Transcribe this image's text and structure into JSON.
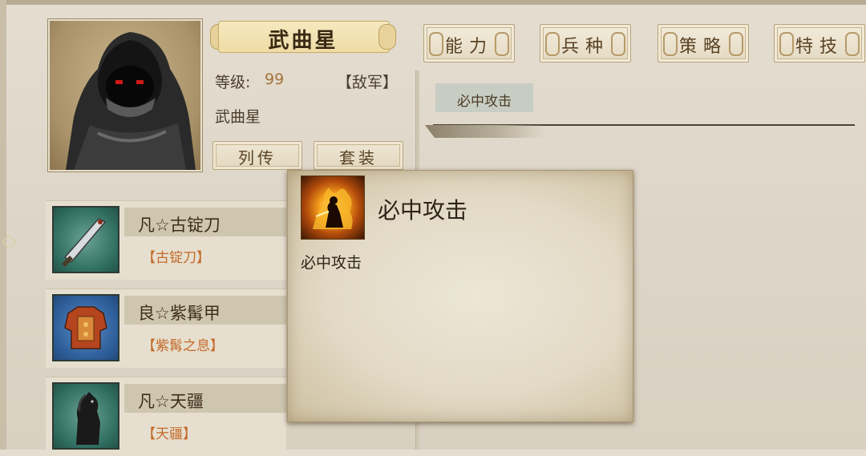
{
  "hero": {
    "name": "武曲星",
    "level_label": "等级:",
    "level_value": "99",
    "faction": "【敌军】",
    "subname": "武曲星"
  },
  "buttons": {
    "biography": "列传",
    "set": "套装"
  },
  "tabs": [
    "能力",
    "兵种",
    "策略",
    "特技"
  ],
  "skills": {
    "selected": "必中攻击"
  },
  "equipment": [
    {
      "title": "凡☆古锭刀",
      "sub": "【古锭刀】",
      "icon": "blade-icon"
    },
    {
      "title": "良☆紫髯甲",
      "sub": "【紫髯之息】",
      "icon": "armor-icon"
    },
    {
      "title": "凡☆天疆",
      "sub": "【天疆】",
      "icon": "horse-icon"
    }
  ],
  "tooltip": {
    "title": "必中攻击",
    "desc": "必中攻击",
    "icon": "flame-warrior-icon"
  },
  "colors": {
    "accent": "#c46a2a",
    "text": "#3e2e1c",
    "parchment": "#e4ddd0"
  }
}
